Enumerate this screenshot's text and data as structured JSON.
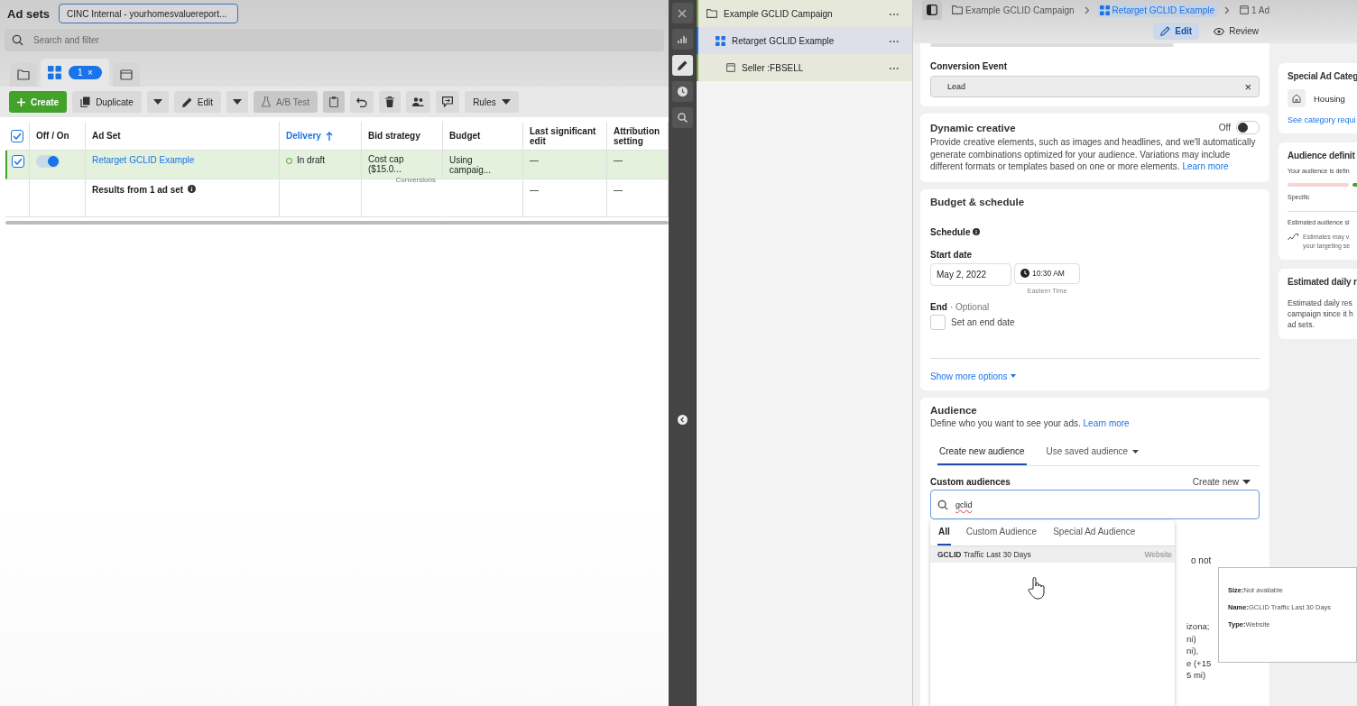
{
  "left": {
    "title": "Ad sets",
    "account": "CINC Internal - yourhomesvaluereport...",
    "search": {
      "placeholder": "Search and filter"
    },
    "tabs": [
      {
        "kind": "campaigns",
        "selected": false
      },
      {
        "kind": "adsets",
        "badge": "1",
        "close": "×",
        "selected": true
      },
      {
        "kind": "ads",
        "selected": false
      }
    ],
    "toolbar": {
      "create": "Create",
      "duplicate": "Duplicate",
      "edit": "Edit",
      "ab_test": "A/B Test",
      "rules": "Rules"
    },
    "columns": [
      {
        "label": "Off / On",
        "sorted": false
      },
      {
        "label": "Ad Set",
        "sorted": false
      },
      {
        "label": "Delivery",
        "sorted": true
      },
      {
        "label": "Bid strategy",
        "sorted": false
      },
      {
        "label": "Budget",
        "sorted": false
      },
      {
        "label": "Last significant edit",
        "sorted": false
      },
      {
        "label": "Attribution setting",
        "sorted": false
      }
    ],
    "header_checked": true,
    "rows": [
      {
        "selected": true,
        "on": true,
        "name": "Retarget GCLID Example",
        "delivery": "In draft",
        "bid": "Cost cap ($15.0...",
        "bid_sub": "Conversions",
        "budget": "Using campaig...",
        "last_edit": "—",
        "attribution": "—"
      }
    ],
    "summary": {
      "label": "Results from 1 ad set",
      "last_edit": "—",
      "attribution": "—"
    }
  },
  "rail": [
    {
      "kind": "close",
      "selected": false
    },
    {
      "kind": "chart",
      "selected": false
    },
    {
      "kind": "edit",
      "selected": true
    },
    {
      "kind": "history",
      "selected": false
    },
    {
      "kind": "search",
      "selected": false
    }
  ],
  "tree": [
    {
      "kind": "campaign",
      "label": "Example GCLID Campaign",
      "more": "•••",
      "selected": false,
      "children": [
        {
          "kind": "adset",
          "label": "Retarget GCLID Example",
          "more": "•••",
          "selected": true,
          "children": [
            {
              "kind": "ad",
              "label": "Seller :FBSELL",
              "more": "•••",
              "selected": false
            }
          ]
        }
      ]
    }
  ],
  "breadcrumb": [
    {
      "kind": "campaign",
      "label": "Example GCLID Campaign",
      "selected": false
    },
    {
      "kind": "adset",
      "label": "Retarget GCLID Example",
      "selected": true
    },
    {
      "kind": "ad",
      "label": "1 Ad",
      "selected": false
    }
  ],
  "modes": [
    {
      "kind": "edit",
      "label": "Edit",
      "selected": true
    },
    {
      "kind": "review",
      "label": "Review",
      "selected": false
    }
  ],
  "conversion": {
    "label": "Conversion Event",
    "value": "Lead",
    "clear": "×"
  },
  "dynamic": {
    "title": "Dynamic creative",
    "state": "Off",
    "on": false,
    "text": "Provide creative elements, such as images and headlines, and we'll automatically generate combinations optimized for your audience. Variations may include different formats or templates based on one or more elements.",
    "link": "Learn more"
  },
  "budget": {
    "title": "Budget & schedule",
    "schedule": "Schedule",
    "start_label": "Start date",
    "date": "May 2, 2022",
    "time": "10:30 AM",
    "timezone": "Eastern Time",
    "end_label": "End",
    "end_optional": "· Optional",
    "end_checkbox": {
      "label": "Set an end date",
      "checked": false
    },
    "more": "Show more options"
  },
  "audience": {
    "title": "Audience",
    "text": "Define who you want to see your ads.",
    "link": "Learn more",
    "tabs": [
      {
        "label": "Create new audience",
        "selected": true
      },
      {
        "label": "Use saved audience",
        "selected": false
      }
    ],
    "custom_label": "Custom audiences",
    "create_new": "Create new",
    "search_value": "gclid",
    "hidden_fragments": [
      "o not",
      "izona;",
      "ni)",
      "ni),",
      "e (+15",
      "5 mi)"
    ]
  },
  "dropdown": {
    "tabs": [
      {
        "label": "All",
        "selected": true
      },
      {
        "label": "Custom Audience",
        "selected": false
      },
      {
        "label": "Special Ad Audience",
        "selected": false
      }
    ],
    "results": [
      {
        "name": "**GCLID** Traffic Last 30 Days",
        "type": "Website",
        "selected": true
      }
    ]
  },
  "tooltip": [
    "**Size:**Not available",
    "**Name:**GCLID Traffic Last 30 Days",
    "**Type:**Website"
  ],
  "side": {
    "special_title": "Special Ad Categ",
    "housing": "Housing",
    "see": "See category requi",
    "definition_title": "Audience definit",
    "definition_text": "Your audience is defin",
    "specific": "Specific",
    "estimated_size": "Estimated audience si",
    "estimates": [
      "Estimates may v",
      "your targeting se"
    ],
    "daily_title": "Estimated daily r",
    "daily_text": [
      "Estimated daily res",
      "campaign since it h",
      "ad sets."
    ]
  }
}
